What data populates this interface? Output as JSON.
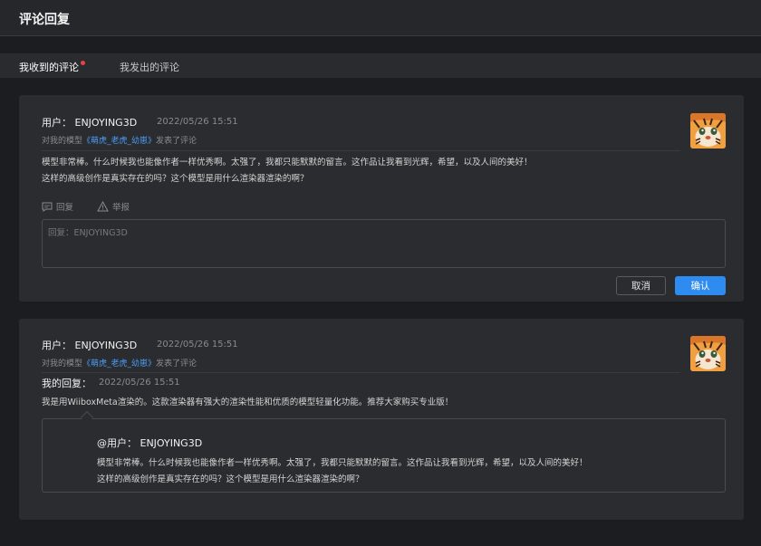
{
  "header": {
    "title": "评论回复"
  },
  "tabs": [
    {
      "label": "我收到的评论",
      "active": true,
      "has_dot": true
    },
    {
      "label": "我发出的评论",
      "active": false
    }
  ],
  "colors": {
    "accent": "#2e8cf0",
    "link": "#4a9cf5",
    "notify_dot": "#e8423f"
  },
  "comments": [
    {
      "user": "用户：  ENJOYING3D",
      "date": "2022/05/26 15:51",
      "meta_prefix": "对我的模型",
      "model_name": "《萌虎_老虎_幼崽》",
      "meta_suffix": "发表了评论",
      "text_lines": [
        "模型非常棒。什么时候我也能像作者一样优秀啊。太强了，我都只能默默的留言。这作品让我看到光辉，希望，以及人间的美好！",
        "这样的高级创作是真实存在的吗？这个模型是用什么渲染器渲染的啊？"
      ],
      "avatar_icon": "tiger-avatar-icon",
      "actions": {
        "reply_label": "回复",
        "report_label": "举报"
      },
      "reply_placeholder": "回复：ENJOYING3D",
      "buttons": {
        "cancel_label": "取消",
        "confirm_label": "确认"
      }
    },
    {
      "user": "用户：  ENJOYING3D",
      "date": "2022/05/26 15:51",
      "meta_prefix": "对我的模型",
      "model_name": "《萌虎_老虎_幼崽》",
      "meta_suffix": "发表了评论",
      "avatar_icon": "tiger-avatar-icon",
      "my_reply_label": "我的回复：",
      "my_reply_date": "2022/05/26 15:51",
      "my_reply_text": "我是用WiiboxMeta渲染的。这款渲染器有强大的渲染性能和优质的模型轻量化功能。推荐大家购买专业版！",
      "quoted_user": "@用户：  ENJOYING3D",
      "quoted_lines": [
        "模型非常棒。什么时候我也能像作者一样优秀啊。太强了，我都只能默默的留言。这作品让我看到光辉，希望，以及人间的美好！",
        "这样的高级创作是真实存在的吗？这个模型是用什么渲染器渲染的啊？"
      ]
    }
  ]
}
